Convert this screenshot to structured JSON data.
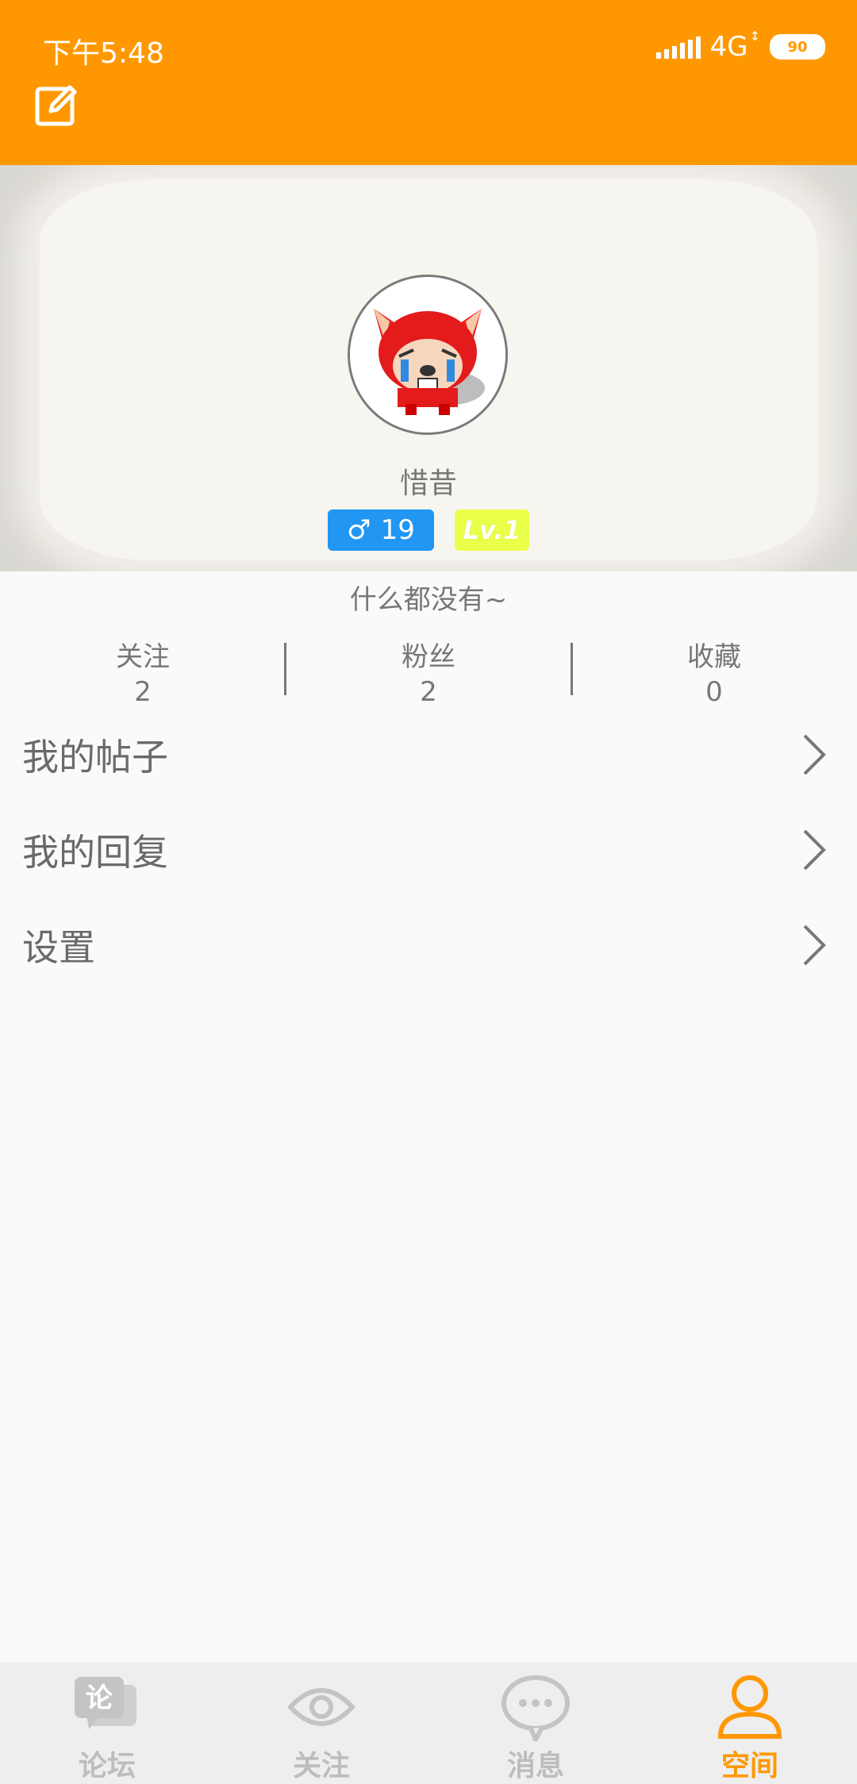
{
  "status_bar": {
    "time": "下午5:48",
    "network": "4G",
    "battery": "90"
  },
  "profile": {
    "username": "惜昔",
    "age": "19",
    "gender_symbol": "♂",
    "level": "Lv.1",
    "bio": "什么都没有~"
  },
  "stats": [
    {
      "label": "关注",
      "value": "2"
    },
    {
      "label": "粉丝",
      "value": "2"
    },
    {
      "label": "收藏",
      "value": "0"
    }
  ],
  "menu": [
    {
      "label": "我的帖子"
    },
    {
      "label": "我的回复"
    },
    {
      "label": "设置"
    }
  ],
  "bottom_nav": [
    {
      "label": "论坛",
      "icon": "forum-icon",
      "icon_text": "论"
    },
    {
      "label": "关注",
      "icon": "eye-icon"
    },
    {
      "label": "消息",
      "icon": "chat-icon"
    },
    {
      "label": "空间",
      "icon": "user-icon",
      "active": true
    }
  ],
  "colors": {
    "accent": "#ff9800",
    "gender_badge": "#2196f3",
    "level_badge": "#eaff4a"
  }
}
